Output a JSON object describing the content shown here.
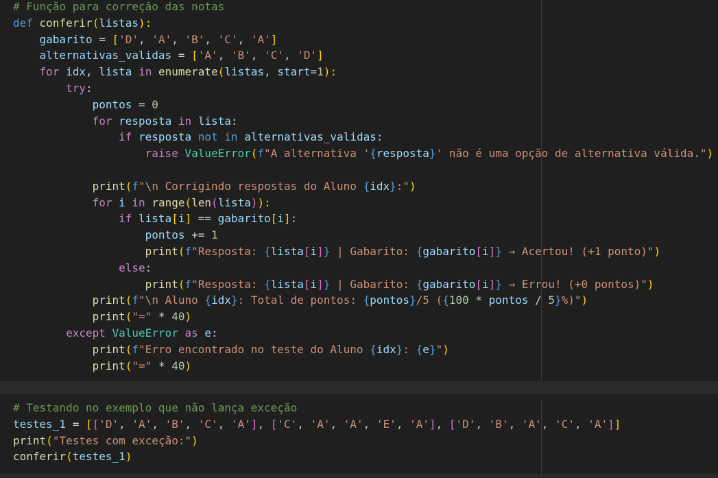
{
  "colors": {
    "background": "#1f1f1f",
    "separator": "#2a2a2a",
    "comment": "#6a9955",
    "keyword": "#569cd6",
    "control": "#c586c0",
    "function": "#dcdcaa",
    "variable": "#9cdcfe",
    "string": "#ce9178",
    "number": "#b5cea8",
    "class": "#4ec9b0",
    "operator": "#d4d4d4",
    "bracket1": "#ffd700",
    "bracket2": "#da70d6",
    "bracket3": "#179fff",
    "plain": "#cccccc"
  },
  "cells": [
    {
      "lines": [
        [
          [
            "# Função para correção das notas",
            "comment"
          ]
        ],
        [
          [
            "def",
            "keyword"
          ],
          [
            " ",
            "plain"
          ],
          [
            "conferir",
            "function"
          ],
          [
            "(",
            "bracket1"
          ],
          [
            "listas",
            "variable"
          ],
          [
            "):",
            "bracket1"
          ]
        ],
        [
          [
            "    ",
            "plain"
          ],
          [
            "gabarito",
            "variable"
          ],
          [
            " = ",
            "operator"
          ],
          [
            "[",
            "bracket1"
          ],
          [
            "'D'",
            "string"
          ],
          [
            ", ",
            "plain"
          ],
          [
            "'A'",
            "string"
          ],
          [
            ", ",
            "plain"
          ],
          [
            "'B'",
            "string"
          ],
          [
            ", ",
            "plain"
          ],
          [
            "'C'",
            "string"
          ],
          [
            ", ",
            "plain"
          ],
          [
            "'A'",
            "string"
          ],
          [
            "]",
            "bracket1"
          ]
        ],
        [
          [
            "    ",
            "plain"
          ],
          [
            "alternativas_validas",
            "variable"
          ],
          [
            " = ",
            "operator"
          ],
          [
            "[",
            "bracket1"
          ],
          [
            "'A'",
            "string"
          ],
          [
            ", ",
            "plain"
          ],
          [
            "'B'",
            "string"
          ],
          [
            ", ",
            "plain"
          ],
          [
            "'C'",
            "string"
          ],
          [
            ", ",
            "plain"
          ],
          [
            "'D'",
            "string"
          ],
          [
            "]",
            "bracket1"
          ]
        ],
        [
          [
            "    ",
            "plain"
          ],
          [
            "for",
            "control"
          ],
          [
            " ",
            "plain"
          ],
          [
            "idx",
            "variable"
          ],
          [
            ", ",
            "plain"
          ],
          [
            "lista",
            "variable"
          ],
          [
            " ",
            "plain"
          ],
          [
            "in",
            "control"
          ],
          [
            " ",
            "plain"
          ],
          [
            "enumerate",
            "function"
          ],
          [
            "(",
            "bracket1"
          ],
          [
            "listas",
            "variable"
          ],
          [
            ", ",
            "plain"
          ],
          [
            "start",
            "variable"
          ],
          [
            "=",
            "operator"
          ],
          [
            "1",
            "number"
          ],
          [
            "):",
            "bracket1"
          ]
        ],
        [
          [
            "        ",
            "plain"
          ],
          [
            "try",
            "control"
          ],
          [
            ":",
            "plain"
          ]
        ],
        [
          [
            "            ",
            "plain"
          ],
          [
            "pontos",
            "variable"
          ],
          [
            " = ",
            "operator"
          ],
          [
            "0",
            "number"
          ]
        ],
        [
          [
            "            ",
            "plain"
          ],
          [
            "for",
            "control"
          ],
          [
            " ",
            "plain"
          ],
          [
            "resposta",
            "variable"
          ],
          [
            " ",
            "plain"
          ],
          [
            "in",
            "control"
          ],
          [
            " ",
            "plain"
          ],
          [
            "lista",
            "variable"
          ],
          [
            ":",
            "plain"
          ]
        ],
        [
          [
            "                ",
            "plain"
          ],
          [
            "if",
            "control"
          ],
          [
            " ",
            "plain"
          ],
          [
            "resposta",
            "variable"
          ],
          [
            " ",
            "plain"
          ],
          [
            "not",
            "keyword"
          ],
          [
            " ",
            "plain"
          ],
          [
            "in",
            "keyword"
          ],
          [
            " ",
            "plain"
          ],
          [
            "alternativas_validas",
            "variable"
          ],
          [
            ":",
            "plain"
          ]
        ],
        [
          [
            "                    ",
            "plain"
          ],
          [
            "raise",
            "control"
          ],
          [
            " ",
            "plain"
          ],
          [
            "ValueError",
            "class"
          ],
          [
            "(",
            "bracket1"
          ],
          [
            "f",
            "keyword"
          ],
          [
            "\"A alternativa '",
            "string"
          ],
          [
            "{",
            "keyword"
          ],
          [
            "resposta",
            "variable"
          ],
          [
            "}",
            "keyword"
          ],
          [
            "' não é uma opção de alternativa válida.\"",
            "string"
          ],
          [
            ")",
            "bracket1"
          ]
        ],
        [
          [
            "",
            "plain"
          ]
        ],
        [
          [
            "            ",
            "plain"
          ],
          [
            "print",
            "function"
          ],
          [
            "(",
            "bracket1"
          ],
          [
            "f",
            "keyword"
          ],
          [
            "\"\\n Corrigindo respostas do Aluno ",
            "string"
          ],
          [
            "{",
            "keyword"
          ],
          [
            "idx",
            "variable"
          ],
          [
            "}",
            "keyword"
          ],
          [
            ":\"",
            "string"
          ],
          [
            ")",
            "bracket1"
          ]
        ],
        [
          [
            "            ",
            "plain"
          ],
          [
            "for",
            "control"
          ],
          [
            " ",
            "plain"
          ],
          [
            "i",
            "variable"
          ],
          [
            " ",
            "plain"
          ],
          [
            "in",
            "control"
          ],
          [
            " ",
            "plain"
          ],
          [
            "range",
            "function"
          ],
          [
            "(",
            "bracket1"
          ],
          [
            "len",
            "function"
          ],
          [
            "(",
            "bracket2"
          ],
          [
            "lista",
            "variable"
          ],
          [
            ")",
            "bracket2"
          ],
          [
            "):",
            "bracket1"
          ]
        ],
        [
          [
            "                ",
            "plain"
          ],
          [
            "if",
            "control"
          ],
          [
            " ",
            "plain"
          ],
          [
            "lista",
            "variable"
          ],
          [
            "[",
            "bracket1"
          ],
          [
            "i",
            "variable"
          ],
          [
            "]",
            "bracket1"
          ],
          [
            " == ",
            "operator"
          ],
          [
            "gabarito",
            "variable"
          ],
          [
            "[",
            "bracket1"
          ],
          [
            "i",
            "variable"
          ],
          [
            "]",
            "bracket1"
          ],
          [
            ":",
            "plain"
          ]
        ],
        [
          [
            "                    ",
            "plain"
          ],
          [
            "pontos",
            "variable"
          ],
          [
            " += ",
            "operator"
          ],
          [
            "1",
            "number"
          ]
        ],
        [
          [
            "                    ",
            "plain"
          ],
          [
            "print",
            "function"
          ],
          [
            "(",
            "bracket1"
          ],
          [
            "f",
            "keyword"
          ],
          [
            "\"Resposta: ",
            "string"
          ],
          [
            "{",
            "keyword"
          ],
          [
            "lista",
            "variable"
          ],
          [
            "[",
            "bracket2"
          ],
          [
            "i",
            "variable"
          ],
          [
            "]",
            "bracket2"
          ],
          [
            "}",
            "keyword"
          ],
          [
            " | Gabarito: ",
            "string"
          ],
          [
            "{",
            "keyword"
          ],
          [
            "gabarito",
            "variable"
          ],
          [
            "[",
            "bracket2"
          ],
          [
            "i",
            "variable"
          ],
          [
            "]",
            "bracket2"
          ],
          [
            "}",
            "keyword"
          ],
          [
            " → Acertou! (+1 ponto)\"",
            "string"
          ],
          [
            ")",
            "bracket1"
          ]
        ],
        [
          [
            "                ",
            "plain"
          ],
          [
            "else",
            "control"
          ],
          [
            ":",
            "plain"
          ]
        ],
        [
          [
            "                    ",
            "plain"
          ],
          [
            "print",
            "function"
          ],
          [
            "(",
            "bracket1"
          ],
          [
            "f",
            "keyword"
          ],
          [
            "\"Resposta: ",
            "string"
          ],
          [
            "{",
            "keyword"
          ],
          [
            "lista",
            "variable"
          ],
          [
            "[",
            "bracket2"
          ],
          [
            "i",
            "variable"
          ],
          [
            "]",
            "bracket2"
          ],
          [
            "}",
            "keyword"
          ],
          [
            " | Gabarito: ",
            "string"
          ],
          [
            "{",
            "keyword"
          ],
          [
            "gabarito",
            "variable"
          ],
          [
            "[",
            "bracket2"
          ],
          [
            "i",
            "variable"
          ],
          [
            "]",
            "bracket2"
          ],
          [
            "}",
            "keyword"
          ],
          [
            " → Errou! (+0 pontos)\"",
            "string"
          ],
          [
            ")",
            "bracket1"
          ]
        ],
        [
          [
            "            ",
            "plain"
          ],
          [
            "print",
            "function"
          ],
          [
            "(",
            "bracket1"
          ],
          [
            "f",
            "keyword"
          ],
          [
            "\"\\n Aluno ",
            "string"
          ],
          [
            "{",
            "keyword"
          ],
          [
            "idx",
            "variable"
          ],
          [
            "}",
            "keyword"
          ],
          [
            ": Total de pontos: ",
            "string"
          ],
          [
            "{",
            "keyword"
          ],
          [
            "pontos",
            "variable"
          ],
          [
            "}",
            "keyword"
          ],
          [
            "/5 (",
            "string"
          ],
          [
            "{",
            "keyword"
          ],
          [
            "100",
            "number"
          ],
          [
            " * ",
            "operator"
          ],
          [
            "pontos",
            "variable"
          ],
          [
            " / ",
            "operator"
          ],
          [
            "5",
            "number"
          ],
          [
            "}",
            "keyword"
          ],
          [
            "%)\"",
            "string"
          ],
          [
            ")",
            "bracket1"
          ]
        ],
        [
          [
            "            ",
            "plain"
          ],
          [
            "print",
            "function"
          ],
          [
            "(",
            "bracket1"
          ],
          [
            "\"=\"",
            "string"
          ],
          [
            " * ",
            "operator"
          ],
          [
            "40",
            "number"
          ],
          [
            ")",
            "bracket1"
          ]
        ],
        [
          [
            "        ",
            "plain"
          ],
          [
            "except",
            "control"
          ],
          [
            " ",
            "plain"
          ],
          [
            "ValueError",
            "class"
          ],
          [
            " ",
            "plain"
          ],
          [
            "as",
            "control"
          ],
          [
            " ",
            "plain"
          ],
          [
            "e",
            "variable"
          ],
          [
            ":",
            "plain"
          ]
        ],
        [
          [
            "            ",
            "plain"
          ],
          [
            "print",
            "function"
          ],
          [
            "(",
            "bracket1"
          ],
          [
            "f",
            "keyword"
          ],
          [
            "\"Erro encontrado no teste do Aluno ",
            "string"
          ],
          [
            "{",
            "keyword"
          ],
          [
            "idx",
            "variable"
          ],
          [
            "}",
            "keyword"
          ],
          [
            ": ",
            "string"
          ],
          [
            "{",
            "keyword"
          ],
          [
            "e",
            "variable"
          ],
          [
            "}",
            "keyword"
          ],
          [
            "\"",
            "string"
          ],
          [
            ")",
            "bracket1"
          ]
        ],
        [
          [
            "            ",
            "plain"
          ],
          [
            "print",
            "function"
          ],
          [
            "(",
            "bracket1"
          ],
          [
            "\"=\"",
            "string"
          ],
          [
            " * ",
            "operator"
          ],
          [
            "40",
            "number"
          ],
          [
            ")",
            "bracket1"
          ]
        ]
      ]
    },
    {
      "lines": [
        [
          [
            "# Testando no exemplo que não lança exceção",
            "comment"
          ]
        ],
        [
          [
            "testes_1",
            "variable"
          ],
          [
            " = ",
            "operator"
          ],
          [
            "[",
            "bracket1"
          ],
          [
            "[",
            "bracket2"
          ],
          [
            "'D'",
            "string"
          ],
          [
            ", ",
            "plain"
          ],
          [
            "'A'",
            "string"
          ],
          [
            ", ",
            "plain"
          ],
          [
            "'B'",
            "string"
          ],
          [
            ", ",
            "plain"
          ],
          [
            "'C'",
            "string"
          ],
          [
            ", ",
            "plain"
          ],
          [
            "'A'",
            "string"
          ],
          [
            "]",
            "bracket2"
          ],
          [
            ", ",
            "plain"
          ],
          [
            "[",
            "bracket2"
          ],
          [
            "'C'",
            "string"
          ],
          [
            ", ",
            "plain"
          ],
          [
            "'A'",
            "string"
          ],
          [
            ", ",
            "plain"
          ],
          [
            "'A'",
            "string"
          ],
          [
            ", ",
            "plain"
          ],
          [
            "'E'",
            "string"
          ],
          [
            ", ",
            "plain"
          ],
          [
            "'A'",
            "string"
          ],
          [
            "]",
            "bracket2"
          ],
          [
            ", ",
            "plain"
          ],
          [
            "[",
            "bracket2"
          ],
          [
            "'D'",
            "string"
          ],
          [
            ", ",
            "plain"
          ],
          [
            "'B'",
            "string"
          ],
          [
            ", ",
            "plain"
          ],
          [
            "'A'",
            "string"
          ],
          [
            ", ",
            "plain"
          ],
          [
            "'C'",
            "string"
          ],
          [
            ", ",
            "plain"
          ],
          [
            "'A'",
            "string"
          ],
          [
            "]",
            "bracket2"
          ],
          [
            "]",
            "bracket1"
          ]
        ],
        [
          [
            "print",
            "function"
          ],
          [
            "(",
            "bracket1"
          ],
          [
            "\"Testes com exceção:\"",
            "string"
          ],
          [
            ")",
            "bracket1"
          ]
        ],
        [
          [
            "conferir",
            "function"
          ],
          [
            "(",
            "bracket1"
          ],
          [
            "testes_1",
            "variable"
          ],
          [
            ")",
            "bracket1"
          ]
        ]
      ]
    }
  ]
}
